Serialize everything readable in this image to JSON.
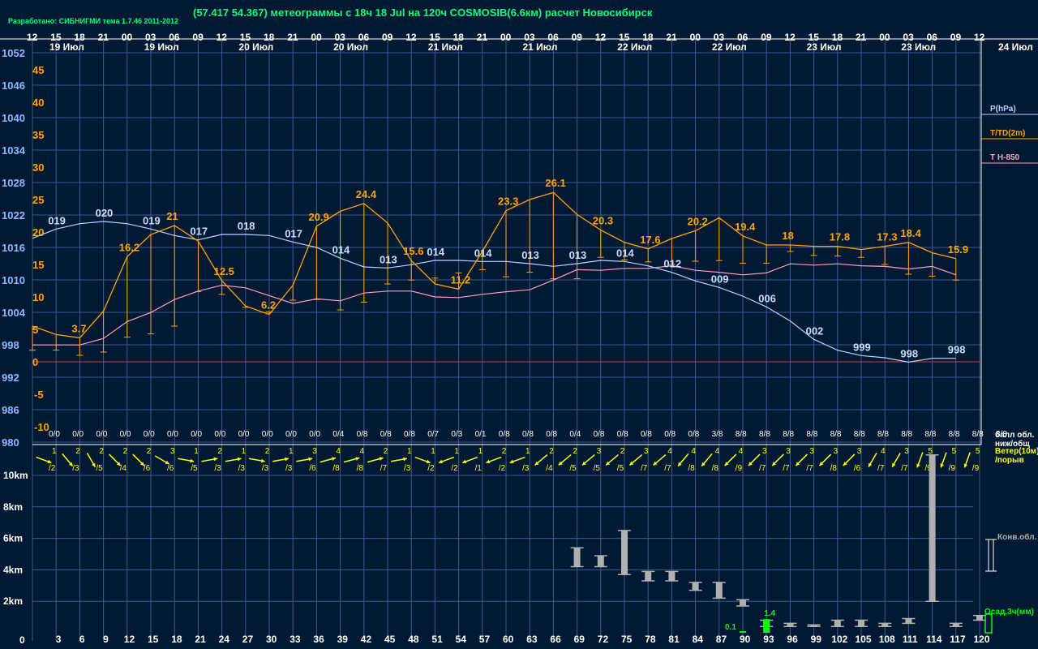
{
  "header": {
    "credit": "Разработано: СИБНИГМИ тема 1.7.46 2011-2012",
    "title": "(57.417 54.367) метеограммы с  18ч 18 Jul на 120ч COSMOSIB(6.6км) расчет Новосибирск"
  },
  "legend": {
    "pressure": "P(hPa)",
    "temp": "T/TD(2m)",
    "t850": "T H-850",
    "cloud_row": "балл обл. ниж/общ",
    "wind_row": "Ветер(10м) /порыв",
    "conv": "Конв.обл.",
    "precip": "Осад,3ч(мм)"
  },
  "colors": {
    "background": "#011933",
    "grid": "#3d5c8a",
    "pressure": "#b9d3ff",
    "temp": "#ffa500",
    "t850": "#ff9ec4",
    "zero_line": "#c44040",
    "wind": "#ffff00",
    "conv": "#b0b0b0",
    "precip": "#00ff00"
  },
  "chart_data": {
    "type": "line",
    "time_hours_ticks": [
      "12",
      "15",
      "18",
      "21",
      "00",
      "03",
      "06",
      "09",
      "12",
      "15",
      "18",
      "21",
      "00",
      "03",
      "06",
      "09",
      "12",
      "15",
      "18",
      "21",
      "00",
      "03",
      "06",
      "09",
      "12",
      "15",
      "18",
      "21",
      "00",
      "03",
      "06",
      "09",
      "12",
      "15",
      "18",
      "21",
      "00",
      "03",
      "06",
      "09",
      "12"
    ],
    "date_labels": [
      "19 Июл",
      "19 Июл",
      "20 Июл",
      "20 Июл",
      "21 Июл",
      "21 Июл",
      "22 Июл",
      "22 Июл",
      "23 Июл",
      "23 Июл",
      "24 Июл"
    ],
    "forecast_hour_ticks": [
      "0",
      "3",
      "6",
      "9",
      "12",
      "15",
      "18",
      "21",
      "24",
      "27",
      "30",
      "33",
      "36",
      "39",
      "42",
      "45",
      "48",
      "51",
      "54",
      "57",
      "60",
      "63",
      "66",
      "69",
      "72",
      "75",
      "78",
      "81",
      "84",
      "87",
      "90",
      "93",
      "96",
      "99",
      "102",
      "105",
      "108",
      "111",
      "114",
      "117",
      "120"
    ],
    "pressure_axis": {
      "ticks": [
        "1052",
        "1046",
        "1040",
        "1034",
        "1028",
        "1022",
        "1016",
        "1010",
        "1004",
        "998",
        "992",
        "986",
        "980"
      ],
      "ylim": [
        980,
        1052
      ]
    },
    "temp_axis": {
      "ticks": [
        "45",
        "40",
        "35",
        "30",
        "25",
        "20",
        "15",
        "10",
        "5",
        "0",
        "-5",
        "-10"
      ],
      "ylim": [
        -12,
        50
      ]
    },
    "height_axis": {
      "ticks": [
        "10km",
        "8km",
        "6km",
        "4km",
        "2km",
        "0"
      ],
      "ylim": [
        0,
        11
      ]
    },
    "pressure": [
      1017.7,
      1019.4,
      1020.4,
      1020.8,
      1020.4,
      1019.4,
      1018.2,
      1017.4,
      1018.4,
      1018.4,
      1018.2,
      1017.0,
      1016.0,
      1014.0,
      1012.4,
      1012.2,
      1012.8,
      1013.6,
      1013.6,
      1013.4,
      1013.4,
      1013.0,
      1012.5,
      1013.0,
      1013.6,
      1013.4,
      1012.6,
      1011.4,
      1009.8,
      1008.6,
      1007.0,
      1005.0,
      1002.4,
      999.0,
      997.0,
      996.0,
      995.6,
      994.8,
      995.5,
      995.5
    ],
    "pressure_labels": [
      {
        "i": 1,
        "text": "019"
      },
      {
        "i": 3,
        "text": "020"
      },
      {
        "i": 5,
        "text": "019"
      },
      {
        "i": 7,
        "text": "017"
      },
      {
        "i": 9,
        "text": "018"
      },
      {
        "i": 11,
        "text": "017"
      },
      {
        "i": 13,
        "text": "014"
      },
      {
        "i": 15,
        "text": "013"
      },
      {
        "i": 17,
        "text": "014"
      },
      {
        "i": 19,
        "text": "014"
      },
      {
        "i": 21,
        "text": "013"
      },
      {
        "i": 23,
        "text": "013"
      },
      {
        "i": 25,
        "text": "014"
      },
      {
        "i": 27,
        "text": "012"
      },
      {
        "i": 29,
        "text": "009"
      },
      {
        "i": 31,
        "text": "006"
      },
      {
        "i": 33,
        "text": "002"
      },
      {
        "i": 35,
        "text": "999"
      },
      {
        "i": 37,
        "text": "998"
      },
      {
        "i": 39,
        "text": "998"
      }
    ],
    "temperature": [
      5.5,
      4.2,
      3.7,
      7.8,
      16.2,
      19.6,
      21.0,
      18.6,
      12.5,
      8.6,
      7.3,
      11.8,
      20.9,
      23.2,
      24.4,
      21.4,
      15.6,
      12.0,
      11.2,
      17.0,
      23.3,
      25.0,
      26.1,
      22.7,
      20.3,
      18.4,
      17.4,
      19.0,
      20.2,
      22.2,
      19.4,
      18.0,
      18.0,
      17.8,
      17.8,
      17.3,
      17.8,
      18.4,
      16.8,
      15.9
    ],
    "dewpoint": [
      1.8,
      1.8,
      1.0,
      1.5,
      3.8,
      4.3,
      5.5,
      10.8,
      10.4,
      8.4,
      7.7,
      9.5,
      9.6,
      8.0,
      9.2,
      12.0,
      12.6,
      12.9,
      13.7,
      14.2,
      13.1,
      13.8,
      12.8,
      12.8,
      16.1,
      15.7,
      15.4,
      15.0,
      15.5,
      15.6,
      15.2,
      15.2,
      17.0,
      16.4,
      16.3,
      16.1,
      15.0,
      13.5,
      13.2,
      12.6
    ],
    "temp_labels": [
      {
        "i": 2,
        "text": "3.7"
      },
      {
        "i": 4,
        "text": "16.2"
      },
      {
        "i": 6,
        "text": "21"
      },
      {
        "i": 8,
        "text": "12.5"
      },
      {
        "i": 10,
        "text": "6.2"
      },
      {
        "i": 12,
        "text": "20.9"
      },
      {
        "i": 14,
        "text": "24.4"
      },
      {
        "i": 16,
        "text": "15.6"
      },
      {
        "i": 18,
        "text": "11.2"
      },
      {
        "i": 20,
        "text": "23.3"
      },
      {
        "i": 22,
        "text": "26.1"
      },
      {
        "i": 24,
        "text": "20.3"
      },
      {
        "i": 26,
        "text": "17.6"
      },
      {
        "i": 28,
        "text": "20.2"
      },
      {
        "i": 30,
        "text": "19.4"
      },
      {
        "i": 32,
        "text": "18"
      },
      {
        "i": 34,
        "text": "17.8"
      },
      {
        "i": 36,
        "text": "17.3"
      },
      {
        "i": 37,
        "text": "18.4"
      },
      {
        "i": 39,
        "text": "15.9"
      }
    ],
    "t850": [
      2.6,
      2.6,
      2.6,
      3.6,
      6.2,
      7.6,
      9.6,
      10.9,
      11.8,
      11.4,
      10.2,
      9.0,
      9.7,
      9.4,
      10.6,
      10.9,
      10.9,
      10.0,
      9.9,
      10.4,
      10.8,
      11.1,
      12.6,
      14.2,
      14.1,
      14.4,
      14.4,
      14.8,
      14.1,
      13.8,
      13.4,
      13.7,
      15.1,
      14.9,
      15.1,
      14.8,
      14.7,
      14.3,
      14.7,
      13.4
    ],
    "cloud_cover": [
      "0/0",
      "0/0",
      "0/0",
      "0/0",
      "0/0",
      "0/0",
      "0/0",
      "0/0",
      "0/0",
      "0/0",
      "0/0",
      "0/0",
      "0/4",
      "0/8",
      "0/8",
      "0/8",
      "0/7",
      "0/3",
      "0/1",
      "0/8",
      "0/8",
      "0/8",
      "0/4",
      "0/8",
      "0/8",
      "0/8",
      "0/8",
      "0/8",
      "3/8",
      "8/8",
      "8/8",
      "8/8",
      "8/8",
      "8/8",
      "8/8",
      "8/8",
      "8/8",
      "8/8",
      "8/8",
      "8/8",
      "8/8"
    ],
    "wind": [
      {
        "i": 0,
        "dir": 110,
        "spd": "1",
        "gust": "/2"
      },
      {
        "i": 1,
        "dir": 140,
        "spd": "2",
        "gust": "/3"
      },
      {
        "i": 2,
        "dir": 150,
        "spd": "2",
        "gust": "/5"
      },
      {
        "i": 3,
        "dir": 135,
        "spd": "2",
        "gust": "/4"
      },
      {
        "i": 4,
        "dir": 135,
        "spd": "2",
        "gust": "/6"
      },
      {
        "i": 5,
        "dir": 120,
        "spd": "3",
        "gust": "/6"
      },
      {
        "i": 6,
        "dir": 100,
        "spd": "1",
        "gust": "/5"
      },
      {
        "i": 7,
        "dir": 80,
        "spd": "2",
        "gust": "/3"
      },
      {
        "i": 8,
        "dir": 80,
        "spd": "1",
        "gust": "/3"
      },
      {
        "i": 9,
        "dir": 100,
        "spd": "2",
        "gust": "/3"
      },
      {
        "i": 10,
        "dir": 80,
        "spd": "1",
        "gust": "/3"
      },
      {
        "i": 11,
        "dir": 80,
        "spd": "3",
        "gust": "/6"
      },
      {
        "i": 12,
        "dir": 75,
        "spd": "4",
        "gust": "/8"
      },
      {
        "i": 13,
        "dir": 75,
        "spd": "4",
        "gust": "/8"
      },
      {
        "i": 14,
        "dir": 75,
        "spd": "2",
        "gust": "/7"
      },
      {
        "i": 15,
        "dir": 80,
        "spd": "1",
        "gust": "/3"
      },
      {
        "i": 16,
        "dir": 110,
        "spd": "1",
        "gust": "/2"
      },
      {
        "i": 17,
        "dir": 250,
        "spd": "1",
        "gust": "/2"
      },
      {
        "i": 18,
        "dir": 250,
        "spd": "1",
        "gust": "/1"
      },
      {
        "i": 19,
        "dir": 250,
        "spd": "2",
        "gust": "/2"
      },
      {
        "i": 20,
        "dir": 250,
        "spd": "1",
        "gust": "/3"
      },
      {
        "i": 21,
        "dir": 230,
        "spd": "2",
        "gust": "/4"
      },
      {
        "i": 22,
        "dir": 230,
        "spd": "2",
        "gust": "/5"
      },
      {
        "i": 23,
        "dir": 230,
        "spd": "3",
        "gust": "/5"
      },
      {
        "i": 24,
        "dir": 230,
        "spd": "2",
        "gust": "/5"
      },
      {
        "i": 25,
        "dir": 230,
        "spd": "3",
        "gust": "/7"
      },
      {
        "i": 26,
        "dir": 230,
        "spd": "4",
        "gust": "/7"
      },
      {
        "i": 27,
        "dir": 220,
        "spd": "4",
        "gust": "/8"
      },
      {
        "i": 28,
        "dir": 220,
        "spd": "4",
        "gust": "/8"
      },
      {
        "i": 29,
        "dir": 225,
        "spd": "4",
        "gust": "/9"
      },
      {
        "i": 30,
        "dir": 225,
        "spd": "3",
        "gust": "/7"
      },
      {
        "i": 31,
        "dir": 225,
        "spd": "3",
        "gust": "/7"
      },
      {
        "i": 32,
        "dir": 225,
        "spd": "3",
        "gust": "/7"
      },
      {
        "i": 33,
        "dir": 225,
        "spd": "3",
        "gust": "/8"
      },
      {
        "i": 34,
        "dir": 225,
        "spd": "3",
        "gust": "/6"
      },
      {
        "i": 35,
        "dir": 210,
        "spd": "4",
        "gust": "/7"
      },
      {
        "i": 36,
        "dir": 210,
        "spd": "3",
        "gust": "/7"
      },
      {
        "i": 37,
        "dir": 200,
        "spd": "5",
        "gust": "/9"
      },
      {
        "i": 38,
        "dir": 200,
        "spd": "5",
        "gust": "/9"
      },
      {
        "i": 39,
        "dir": 200,
        "spd": "5",
        "gust": "/9"
      }
    ],
    "convective_clouds": [
      {
        "h": 69,
        "base": 4.2,
        "top": 5.4
      },
      {
        "h": 72,
        "base": 4.2,
        "top": 4.9
      },
      {
        "h": 75,
        "base": 3.7,
        "top": 6.5
      },
      {
        "h": 78,
        "base": 3.3,
        "top": 3.9
      },
      {
        "h": 81,
        "base": 3.3,
        "top": 3.9
      },
      {
        "h": 84,
        "base": 2.7,
        "top": 3.2
      },
      {
        "h": 87,
        "base": 2.2,
        "top": 3.2
      },
      {
        "h": 90,
        "base": 1.7,
        "top": 2.1
      },
      {
        "h": 93,
        "base": 0.4,
        "top": 0.8
      },
      {
        "h": 96,
        "base": 0.4,
        "top": 0.6
      },
      {
        "h": 99,
        "base": 0.4,
        "top": 0.5
      },
      {
        "h": 102,
        "base": 0.4,
        "top": 0.8
      },
      {
        "h": 105,
        "base": 0.4,
        "top": 0.8
      },
      {
        "h": 108,
        "base": 0.4,
        "top": 0.6
      },
      {
        "h": 111,
        "base": 0.6,
        "top": 0.9
      },
      {
        "h": 114,
        "base": 2.0,
        "top": 11.3
      },
      {
        "h": 117,
        "base": 0.4,
        "top": 0.6
      },
      {
        "h": 120,
        "base": 0.8,
        "top": 1.1
      }
    ],
    "precipitation": [
      {
        "h": 90,
        "mm": 0.1,
        "label": "0.1"
      },
      {
        "h": 93,
        "mm": 1.4,
        "label": "1.4"
      }
    ]
  }
}
